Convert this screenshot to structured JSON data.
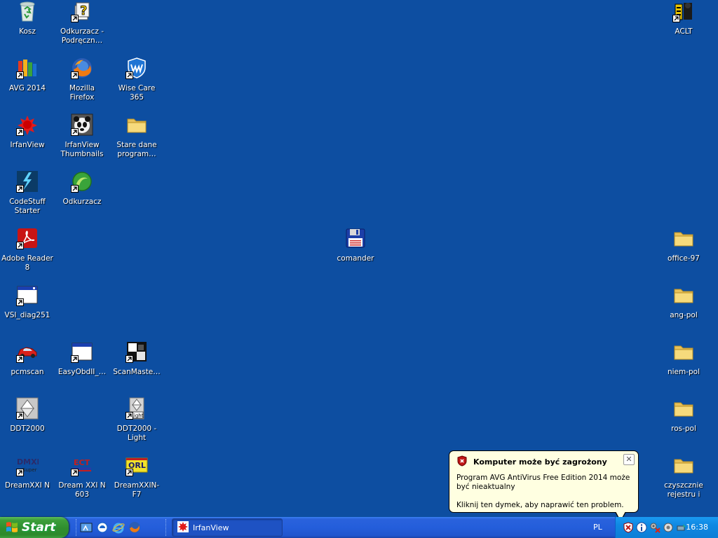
{
  "desktop": {
    "icons": {
      "kosz": "Kosz",
      "odkurzacz_help": "Odkurzacz - Podręczn…",
      "aclt": "ACLT",
      "avg": "AVG 2014",
      "firefox": "Mozilla Firefox",
      "wisecare": "Wise Care 365",
      "irfanview": "IrfanView",
      "irfan_thumbs": "IrfanView Thumbnails",
      "stare_dane": "Stare dane program…",
      "codestuff": "CodeStuff Starter",
      "odkurzacz": "Odkurzacz",
      "adobe": "Adobe Reader 8",
      "comander": "comander",
      "office97": "office-97",
      "vsi": "VSI_diag251",
      "angpol": "ang-pol",
      "pcmscan": "pcmscan",
      "easyobd": "EasyObdII_…",
      "scanmaster": "ScanMaste…",
      "niempol": "niem-pol",
      "ddt2000": "DDT2000",
      "ddt2000light": "DDT2000 - Light",
      "rospol": "ros-pol",
      "dreamxxi_n": "DreamXXI N",
      "dreamxxi_n603": "Dream XXI N 603",
      "dreamxxin_f7": "DreamXXIN-F7",
      "czyszcznie": "czyszcznie rejestru i dysku"
    },
    "icon_badges": {
      "ddt_light": "Light",
      "dreamxxi": "DMXL",
      "dreamxxi_sub": "Super",
      "dream603": "ECT",
      "dreamf7": "ORL"
    }
  },
  "balloon": {
    "title": "Komputer może być zagrożony",
    "message": "Program AVG AntiVirus Free Edition 2014 może być nieaktualny",
    "action": "Kliknij ten dymek, aby naprawić ten problem.",
    "close_symbol": "✕"
  },
  "taskbar": {
    "start_label": "Start",
    "quick_launch": [
      "show-desktop",
      "windows-explorer",
      "internet-explorer",
      "firefox"
    ],
    "tasks": [
      {
        "label": "IrfanView"
      }
    ],
    "language": "PL",
    "tray_icons": [
      "avg-warning",
      "info",
      "network-settings",
      "audio",
      "safely-remove"
    ],
    "clock": "16:38"
  },
  "colors": {
    "desktop": "#0d4ea1",
    "taskbar": "#245edb",
    "start": "#3c9e3a",
    "tray": "#0f88e2",
    "balloon": "#ffffe1"
  }
}
